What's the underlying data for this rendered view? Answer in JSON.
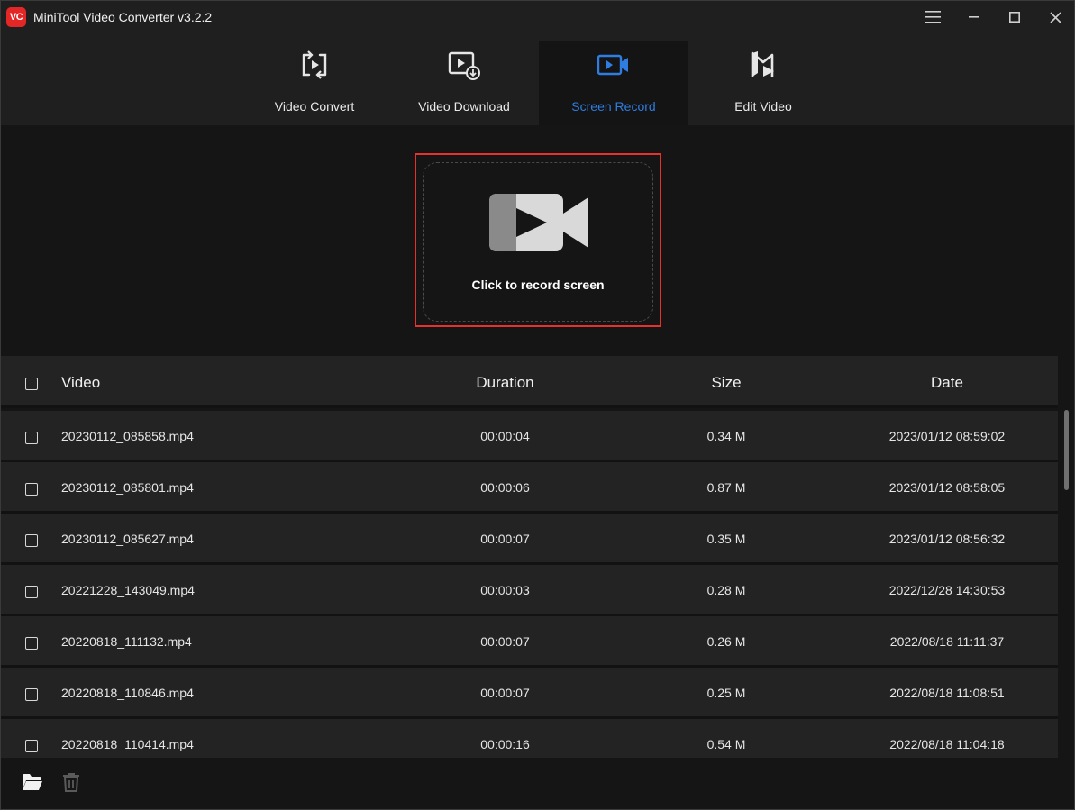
{
  "app": {
    "logo_text": "VC",
    "title": "MiniTool Video Converter v3.2.2"
  },
  "window_controls": {
    "menu_icon": "hamburger-menu-icon",
    "minimize_icon": "minimize-icon",
    "maximize_icon": "maximize-icon",
    "close_icon": "close-icon"
  },
  "tabs": [
    {
      "label": "Video Convert",
      "icon": "video-convert-icon",
      "active": false
    },
    {
      "label": "Video Download",
      "icon": "video-download-icon",
      "active": false
    },
    {
      "label": "Screen Record",
      "icon": "screen-record-icon",
      "active": true
    },
    {
      "label": "Edit Video",
      "icon": "edit-video-icon",
      "active": false
    }
  ],
  "record": {
    "label": "Click to record screen",
    "icon": "video-camera-icon"
  },
  "table": {
    "headers": {
      "video": "Video",
      "duration": "Duration",
      "size": "Size",
      "date": "Date"
    },
    "rows": [
      {
        "video": "20230112_085858.mp4",
        "duration": "00:00:04",
        "size": "0.34 M",
        "date": "2023/01/12 08:59:02"
      },
      {
        "video": "20230112_085801.mp4",
        "duration": "00:00:06",
        "size": "0.87 M",
        "date": "2023/01/12 08:58:05"
      },
      {
        "video": "20230112_085627.mp4",
        "duration": "00:00:07",
        "size": "0.35 M",
        "date": "2023/01/12 08:56:32"
      },
      {
        "video": "20221228_143049.mp4",
        "duration": "00:00:03",
        "size": "0.28 M",
        "date": "2022/12/28 14:30:53"
      },
      {
        "video": "20220818_111132.mp4",
        "duration": "00:00:07",
        "size": "0.26 M",
        "date": "2022/08/18 11:11:37"
      },
      {
        "video": "20220818_110846.mp4",
        "duration": "00:00:07",
        "size": "0.25 M",
        "date": "2022/08/18 11:08:51"
      },
      {
        "video": "20220818_110414.mp4",
        "duration": "00:00:16",
        "size": "0.54 M",
        "date": "2022/08/18 11:04:18"
      }
    ]
  },
  "bottom": {
    "open_folder_icon": "folder-open-icon",
    "delete_icon": "trash-icon"
  },
  "colors": {
    "accent": "#2f7de1",
    "highlight": "#e8312b",
    "logo_red": "#e32626"
  }
}
